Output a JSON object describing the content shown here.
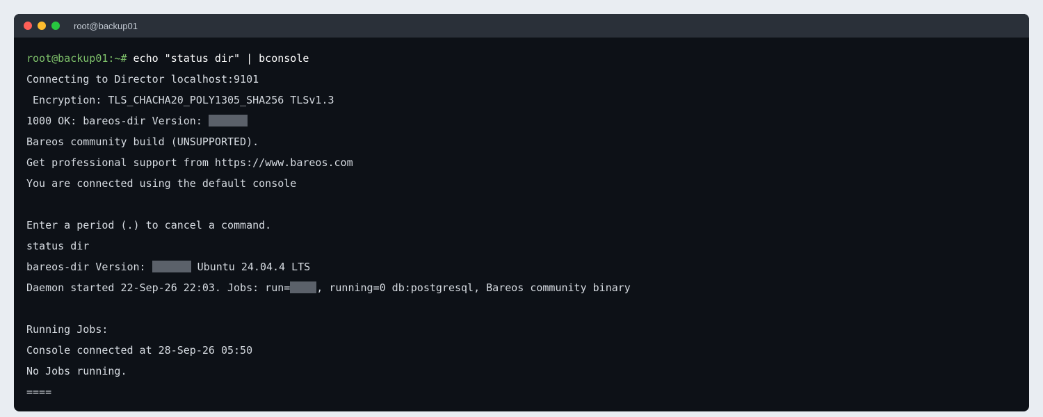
{
  "window": {
    "title": "root@backup01"
  },
  "terminal": {
    "prompt": "root@backup01:~# ",
    "command": "echo \"status dir\" | bconsole",
    "lines": {
      "l1": "Connecting to Director localhost:9101",
      "l2": " Encryption: TLS_CHACHA20_POLY1305_SHA256 TLSv1.3",
      "l3_pre": "1000 OK: bareos-dir Version: ",
      "l4": "Bareos community build (UNSUPPORTED).",
      "l5": "Get professional support from https://www.bareos.com",
      "l6": "You are connected using the default console",
      "l8": "Enter a period (.) to cancel a command.",
      "l9": "status dir",
      "l10_pre": "bareos-dir Version: ",
      "l10_post": " Ubuntu 24.04.4 LTS",
      "l11_pre": "Daemon started 22-Sep-26 22:03. Jobs: run=",
      "l11_post": ", running=0 db:postgresql, Bareos community binary",
      "l13": "Running Jobs:",
      "l14": "Console connected at 28-Sep-26 05:50",
      "l15": "No Jobs running.",
      "l16": "===="
    }
  }
}
